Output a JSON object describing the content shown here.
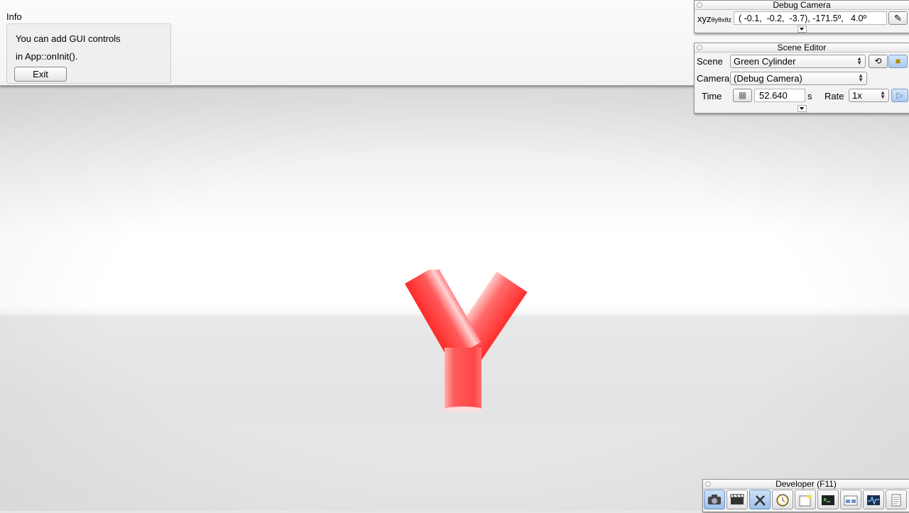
{
  "info": {
    "title": "Info",
    "line1": "You can add GUI controls",
    "line2": "in App::onInit().",
    "exit_label": "Exit"
  },
  "debug_camera": {
    "title": "Debug Camera",
    "xyz_label": "xyz",
    "xyz_sub": "θyθxθz",
    "coords": "( -0.1,  -0.2,  -3.7), -171.5º,   4.0º",
    "edit_icon": "pencil-icon"
  },
  "scene_editor": {
    "title": "Scene Editor",
    "scene_label": "Scene",
    "scene_value": "Green Cylinder",
    "camera_label": "Camera",
    "camera_value": "(Debug Camera)",
    "time_label": "Time",
    "time_value": "52.640",
    "time_unit": "s",
    "rate_label": "Rate",
    "rate_value": "1x",
    "icons": [
      "reload-icon",
      "lock-icon",
      "film-reel-icon",
      "play-icon"
    ]
  },
  "developer": {
    "title": "Developer (F11)",
    "tools": [
      "camera-icon",
      "clapperboard-icon",
      "tools-icon",
      "clock-icon",
      "new-window-icon",
      "console-icon",
      "windows-icon",
      "profiler-icon",
      "document-icon"
    ]
  },
  "colors": {
    "model_red": "#ff3b3b",
    "active_blue": "#a9c8ee"
  }
}
